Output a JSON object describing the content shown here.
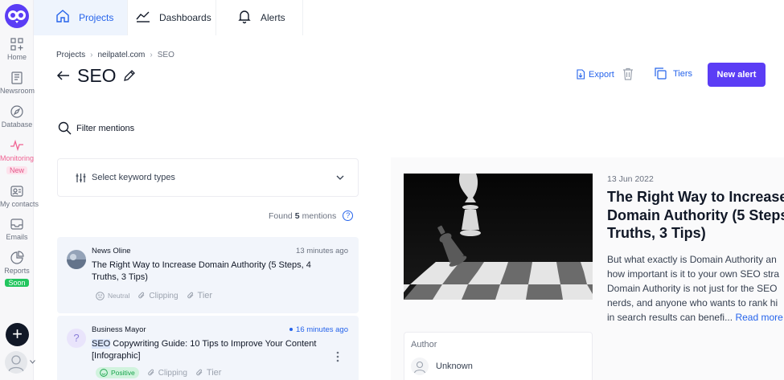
{
  "sidebar": {
    "items": [
      {
        "label": "Home",
        "icon": "home-grid-icon"
      },
      {
        "label": "Newsroom",
        "icon": "newsroom-icon"
      },
      {
        "label": "Database",
        "icon": "compass-icon"
      },
      {
        "label": "Monitoring",
        "icon": "pulse-icon",
        "badge": "New"
      },
      {
        "label": "My contacts",
        "icon": "contacts-icon"
      },
      {
        "label": "Emails",
        "icon": "inbox-icon"
      },
      {
        "label": "Reports",
        "icon": "pie-chart-icon",
        "badge": "Soon"
      }
    ],
    "add_label": "+"
  },
  "tabs": [
    {
      "label": "Projects",
      "icon": "home-icon",
      "active": true
    },
    {
      "label": "Dashboards",
      "icon": "line-chart-icon"
    },
    {
      "label": "Alerts",
      "icon": "bell-icon"
    }
  ],
  "breadcrumb": [
    "Projects",
    "neilpatel.com",
    "SEO"
  ],
  "page": {
    "title": "SEO",
    "back_icon": "arrow-left-icon",
    "edit_icon": "pencil-icon"
  },
  "actions": {
    "export": "Export",
    "tiers": "Tiers",
    "new_alert": "New alert"
  },
  "filters": {
    "filter_mentions": "Filter mentions",
    "keyword_types": "Select keyword types"
  },
  "results": {
    "found_prefix": "Found",
    "count": "5",
    "found_suffix": "mentions",
    "help": "?"
  },
  "mentions": [
    {
      "source": "News Oline",
      "time": "13 minutes ago",
      "title": "The Right Way to Increase Domain Authority (5 Steps, 4 Truths, 3 Tips)",
      "sentiment": "Neutral",
      "clipping": "Clipping",
      "tier": "Tier",
      "unread": false
    },
    {
      "source": "Business Mayor",
      "avatar_text": "?",
      "time": "16 minutes ago",
      "title_highlight": "SEO",
      "title_rest": " Copywriting Guide: 10 Tips to Improve Your Content [Infographic]",
      "sentiment": "Positive",
      "clipping": "Clipping",
      "tier": "Tier",
      "unread": true
    }
  ],
  "article": {
    "date": "13 Jun 2022",
    "title_lines": [
      "The Right Way to Increase",
      "Domain Authority (5 Steps,",
      "Truths, 3 Tips)"
    ],
    "body_lines": [
      "But what exactly is Domain Authority an",
      "how important is it to your own SEO stra",
      "Domain Authority is not just for the SEO",
      "nerds, and anyone who wants to rank hi",
      "in search results can benefi..."
    ],
    "read_more": "Read more",
    "author_label": "Author",
    "author_name": "Unknown"
  },
  "colors": {
    "accent": "#2563eb",
    "primary_button": "#5b3df5",
    "monitoring": "#f06292",
    "positive": "#16a34a"
  }
}
